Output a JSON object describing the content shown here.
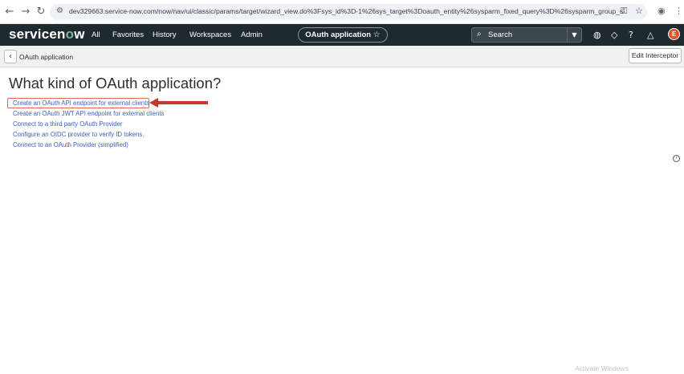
{
  "browser": {
    "url": "dev329663.service-now.com/now/nav/ui/classic/params/target/wizard_view.do%3Fsys_id%3D-1%26sys_target%3Doauth_entity%26sysparm_fixed_query%3D%26sysparm_group_sort%3D%26sys..."
  },
  "header": {
    "logo_text": "servicenow",
    "menu": [
      "All",
      "Favorites",
      "History",
      "Workspaces",
      "Admin"
    ],
    "context_pill": "OAuth application",
    "search_placeholder": "Search",
    "avatar_initials": "E"
  },
  "subheader": {
    "title": "OAuth application",
    "edit_button": "Edit Interceptor"
  },
  "main": {
    "title": "What kind of OAuth application?",
    "options": [
      "Create an OAuth API endpoint for external clients",
      "Create an OAuth JWT API endpoint for external clients",
      "Connect to a third party OAuth Provider",
      "Configure an OIDC provider to verify ID tokens.",
      "Connect to an OAuth Provider (simplified)"
    ]
  },
  "watermark": "Activate Windows",
  "colors": {
    "header_bg": "#1e2a2e",
    "link": "#3a64bc",
    "annotation_red": "#c0392b"
  }
}
